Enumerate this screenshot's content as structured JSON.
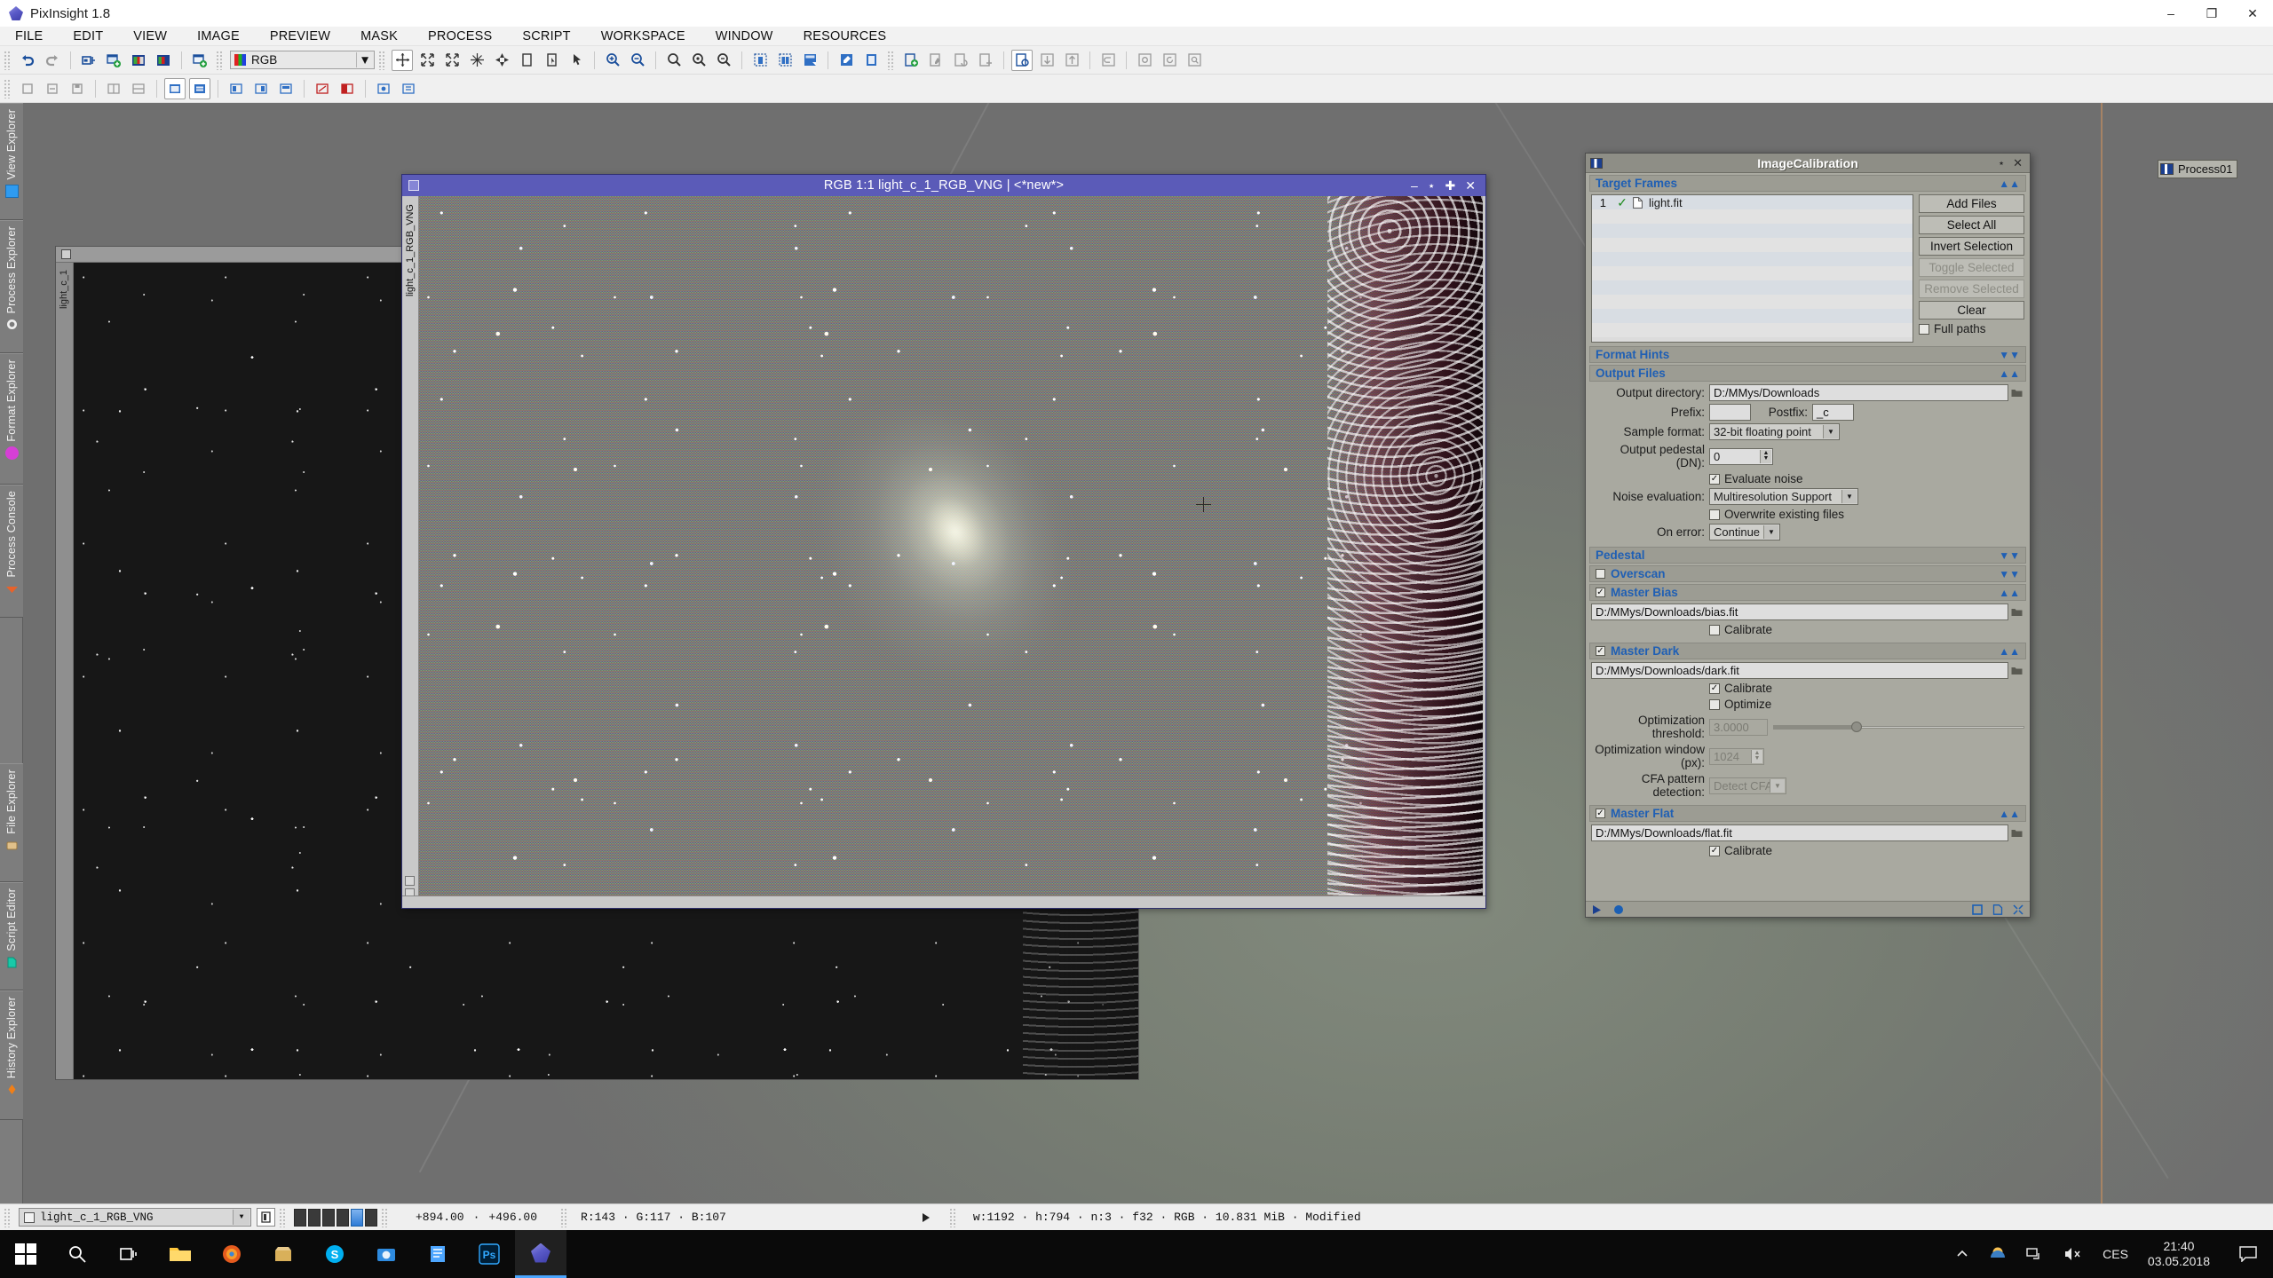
{
  "app": {
    "title": "PixInsight 1.8",
    "icon": "pixinsight-logo-icon",
    "window_controls": [
      "minimize",
      "restore",
      "close"
    ]
  },
  "menu": {
    "items": [
      {
        "label": "FILE",
        "name": "menu-file"
      },
      {
        "label": "EDIT",
        "name": "menu-edit"
      },
      {
        "label": "VIEW",
        "name": "menu-view"
      },
      {
        "label": "IMAGE",
        "name": "menu-image"
      },
      {
        "label": "PREVIEW",
        "name": "menu-preview"
      },
      {
        "label": "MASK",
        "name": "menu-mask"
      },
      {
        "label": "PROCESS",
        "name": "menu-process"
      },
      {
        "label": "SCRIPT",
        "name": "menu-script"
      },
      {
        "label": "WORKSPACE",
        "name": "menu-workspace"
      },
      {
        "label": "WINDOW",
        "name": "menu-window"
      },
      {
        "label": "RESOURCES",
        "name": "menu-resources"
      }
    ]
  },
  "toolbar": {
    "color_space_combo": {
      "value": "RGB",
      "swatch": "rgb-swatch-icon"
    },
    "row1_icons": [
      "undo-icon",
      "redo-icon",
      "new-image-icon",
      "duplicate-image-icon",
      "grayscale-image-icon",
      "rgb-image-icon",
      "new-preview-icon"
    ],
    "row1_icons_right": [
      "move-icon",
      "fit-view-icon",
      "zoom-fit-icon",
      "resample-icon",
      "pan-icon",
      "mask-icon",
      "mask-preview-icon",
      "pointer-icon",
      "zoom-in-icon",
      "zoom-out-icon",
      "zoom-1-1-icon",
      "zoom-optimal-icon",
      "zoom-custom-icon",
      "preview-select-icon",
      "preview-multi-icon",
      "preview-new-icon",
      "preview-edit-icon",
      "preview-apply-icon",
      "process-new-icon",
      "process-edit-icon",
      "process-copy-icon",
      "process-add-icon",
      "process-execute-icon",
      "process-down-icon",
      "process-up-icon",
      "history-icon",
      "reset-icon",
      "reload-icon",
      "browse-icon"
    ],
    "row2_icons": [
      "file-new-icon",
      "file-open-icon",
      "file-save-icon",
      "layout-a-icon",
      "layout-b-icon",
      "win-tile-icon",
      "win-cascade-icon",
      "view-a-icon",
      "view-b-icon",
      "view-c-icon",
      "view-d-icon",
      "mask-show-icon",
      "mask-invert-icon"
    ]
  },
  "left_tabs": [
    {
      "label": "View Explorer",
      "icon": "blue-square-icon",
      "name": "sidebar-item-view-explorer"
    },
    {
      "label": "Process Explorer",
      "icon": "gear-icon",
      "name": "sidebar-item-process-explorer"
    },
    {
      "label": "Format Explorer",
      "icon": "magenta-circle-icon",
      "name": "sidebar-item-format-explorer"
    },
    {
      "label": "Process Console",
      "icon": "console-cone-icon",
      "name": "sidebar-item-process-console"
    }
  ],
  "left_tabs_lower": [
    {
      "label": "File Explorer",
      "icon": "folder-icon",
      "name": "sidebar-item-file-explorer"
    },
    {
      "label": "Script Editor",
      "icon": "script-page-icon",
      "name": "sidebar-item-script-editor"
    },
    {
      "label": "History Explorer",
      "icon": "orange-diamond-icon",
      "name": "sidebar-item-history-explorer"
    }
  ],
  "image_window": {
    "title": "RGB 1:1 light_c_1_RGB_VNG | <*new*>",
    "side_label": "light_c_1_RGB_VNG",
    "buttons": [
      "minimize",
      "maximize",
      "restore",
      "close"
    ]
  },
  "bg_window": {
    "side_label": "light_c_1"
  },
  "process_icon": {
    "label": "Process01",
    "icon": "process-instance-icon"
  },
  "dialog": {
    "title": "ImageCalibration",
    "icon": "imagecalibration-icon",
    "titlebar_buttons": [
      "collapse",
      "close"
    ],
    "target_frames": {
      "section_label": "Target Frames",
      "collapsed": false,
      "rows": [
        {
          "num": "1",
          "checked": true,
          "icon": "file-icon",
          "filename": "light.fit"
        }
      ],
      "empty_rows": 9,
      "buttons": [
        {
          "label": "Add Files",
          "enabled": true
        },
        {
          "label": "Select All",
          "enabled": true
        },
        {
          "label": "Invert Selection",
          "enabled": true
        },
        {
          "label": "Toggle Selected",
          "enabled": false
        },
        {
          "label": "Remove Selected",
          "enabled": false
        },
        {
          "label": "Clear",
          "enabled": true
        }
      ],
      "full_paths": {
        "label": "Full paths",
        "checked": false
      }
    },
    "format_hints": {
      "section_label": "Format Hints",
      "collapsed": true
    },
    "output_files": {
      "section_label": "Output Files",
      "collapsed": false,
      "output_directory": {
        "label": "Output directory:",
        "value": "D:/MMys/Downloads"
      },
      "prefix": {
        "label": "Prefix:",
        "value": ""
      },
      "postfix": {
        "label": "Postfix:",
        "value": "_c"
      },
      "sample_format": {
        "label": "Sample format:",
        "value": "32-bit floating point"
      },
      "output_pedestal": {
        "label": "Output pedestal (DN):",
        "value": "0"
      },
      "evaluate_noise": {
        "label": "Evaluate noise",
        "checked": true
      },
      "noise_evaluation": {
        "label": "Noise evaluation:",
        "value": "Multiresolution Support"
      },
      "overwrite_existing": {
        "label": "Overwrite existing files",
        "checked": false
      },
      "on_error": {
        "label": "On error:",
        "value": "Continue"
      }
    },
    "pedestal": {
      "section_label": "Pedestal",
      "collapsed": true
    },
    "overscan": {
      "section_label": "Overscan",
      "collapsed": true,
      "checked": false
    },
    "master_bias": {
      "section_label": "Master Bias",
      "checked": true,
      "collapsed": false,
      "path": "D:/MMys/Downloads/bias.fit",
      "calibrate": {
        "label": "Calibrate",
        "checked": false
      }
    },
    "master_dark": {
      "section_label": "Master Dark",
      "checked": true,
      "collapsed": false,
      "path": "D:/MMys/Downloads/dark.fit",
      "calibrate": {
        "label": "Calibrate",
        "checked": true
      },
      "optimize": {
        "label": "Optimize",
        "checked": false
      },
      "optimization_threshold": {
        "label": "Optimization threshold:",
        "value": "3.0000",
        "enabled": false
      },
      "optimization_window": {
        "label": "Optimization window (px):",
        "value": "1024",
        "enabled": false
      },
      "cfa_pattern_detection": {
        "label": "CFA pattern detection:",
        "value": "Detect CFA",
        "enabled": false
      }
    },
    "master_flat": {
      "section_label": "Master Flat",
      "checked": true,
      "collapsed": false,
      "path": "D:/MMys/Downloads/flat.fit",
      "calibrate": {
        "label": "Calibrate",
        "checked": true
      }
    },
    "bottom_bar_icons": [
      "apply-triangle-icon",
      "global-apply-icon",
      "new-instance-icon",
      "browse-documentation-icon",
      "reset-icon"
    ]
  },
  "status_bar": {
    "view_selector": {
      "value": "light_c_1_RGB_VNG",
      "icon": "view-icon"
    },
    "readout_button": "readout-mode-icon",
    "channel_swatches": 6,
    "selected_swatch_index": 4,
    "cursor_x": "+894.00",
    "cursor_y": "+496.00",
    "separator": "·",
    "rgb_readout": "R:143 · G:117 · B:107",
    "play_icon": "play-icon",
    "image_info": "w:1192 · h:794 · n:3 · f32 · RGB · 10.831 MiB · Modified"
  },
  "taskbar": {
    "items": [
      {
        "name": "start-button",
        "icon": "windows-logo-icon"
      },
      {
        "name": "search-button",
        "icon": "search-icon"
      },
      {
        "name": "task-view-button",
        "icon": "task-view-icon"
      },
      {
        "name": "taskbar-explorer",
        "icon": "folder-icon"
      },
      {
        "name": "taskbar-firefox",
        "icon": "firefox-icon"
      },
      {
        "name": "taskbar-store",
        "icon": "store-icon"
      },
      {
        "name": "taskbar-skype",
        "icon": "skype-icon"
      },
      {
        "name": "taskbar-camera",
        "icon": "camera-icon"
      },
      {
        "name": "taskbar-notepad",
        "icon": "notepad-icon"
      },
      {
        "name": "taskbar-photoshop",
        "icon": "photoshop-icon"
      },
      {
        "name": "taskbar-pixinsight",
        "icon": "pixinsight-icon"
      }
    ],
    "tray": {
      "chevron": "chevron-up-icon",
      "icons": [
        "weather-icon",
        "network-icon",
        "volume-muted-icon"
      ],
      "language": "CES",
      "time": "21:40",
      "date": "03.05.2018",
      "action_center": "action-center-icon"
    }
  },
  "colors": {
    "title_blue": "#5b5bb8",
    "section_blue": "#1f5fb4",
    "dialog_bg": "#a9a9a0",
    "workspace": "#6e6e6e",
    "check_green": "#1d8a1d"
  }
}
